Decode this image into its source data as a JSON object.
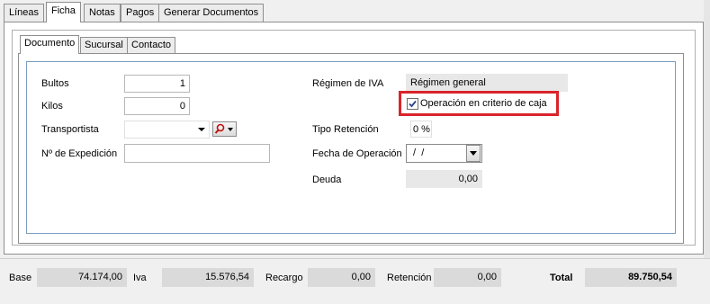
{
  "outer_tabs": [
    "Líneas",
    "Ficha",
    "Notas",
    "Pagos",
    "Generar Documentos"
  ],
  "inner_tabs": [
    "Documento",
    "Sucursal",
    "Contacto"
  ],
  "form": {
    "bultos_label": "Bultos",
    "bultos_value": "1",
    "kilos_label": "Kilos",
    "kilos_value": "0",
    "transportista_label": "Transportista",
    "transportista_value": "",
    "expedicion_label": "Nº de Expedición",
    "expedicion_value": "",
    "regimen_label": "Régimen de IVA",
    "regimen_value": "Régimen general",
    "criterio_caja_label": "Operación en criterio de caja",
    "criterio_caja_checked": true,
    "tipo_retencion_label": "Tipo Retención",
    "tipo_retencion_value": "0 %",
    "fecha_operacion_label": "Fecha de Operación",
    "fecha_operacion_value": " /  /",
    "deuda_label": "Deuda",
    "deuda_value": "0,00"
  },
  "totals": {
    "base_label": "Base",
    "base_value": "74.174,00",
    "iva_label": "Iva",
    "iva_value": "15.576,54",
    "recargo_label": "Recargo",
    "recargo_value": "0,00",
    "retencion_label": "Retención",
    "retencion_value": "0,00",
    "total_label": "Total",
    "total_value": "89.750,54"
  },
  "colors": {
    "highlight_border": "#d9242b",
    "panel_border": "#7a9cbf"
  },
  "icons": {
    "search": "magnifier-icon",
    "dropdown": "chevron-down-icon",
    "check": "checkmark-icon"
  }
}
